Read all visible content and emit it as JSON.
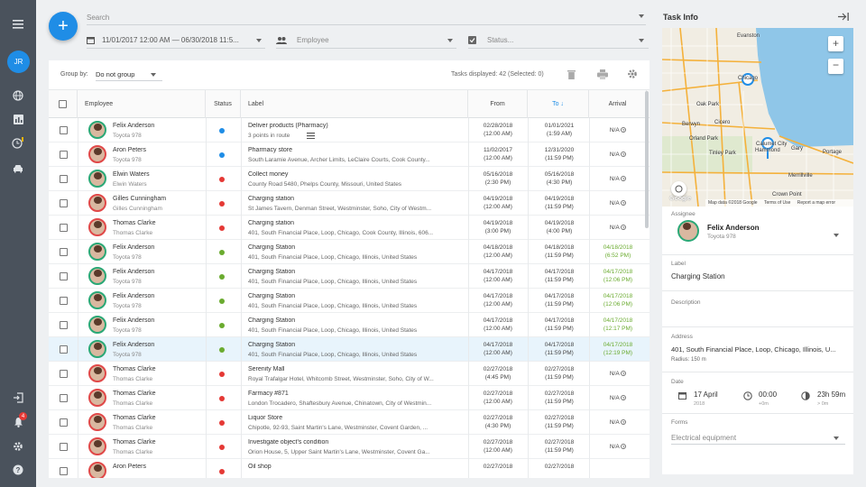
{
  "sidebar": {
    "avatar_initials": "JR",
    "notif_count": "4",
    "icons": [
      "menu-icon",
      "globe-icon",
      "chart-icon",
      "clock-icon",
      "car-icon",
      "logout-icon",
      "bell-icon",
      "gear-icon",
      "help-icon"
    ]
  },
  "search": {
    "placeholder": "Search"
  },
  "filters": {
    "date_range": "11/01/2017 12:00 AM — 06/30/2018 11:5...",
    "employee_placeholder": "Employee",
    "status_placeholder": "Status..."
  },
  "toolbar": {
    "group_by_label": "Group by:",
    "group_by_value": "Do not group",
    "tasks_displayed": "Tasks displayed: 42 (Selected: 0)"
  },
  "table": {
    "headers": {
      "employee": "Employee",
      "status": "Status",
      "label": "Label",
      "from": "From",
      "to": "To",
      "arrival": "Arrival"
    },
    "rows": [
      {
        "name": "Felix Anderson",
        "car": "Toyota 978",
        "status": "blue",
        "label": "Deliver products (Pharmacy)",
        "sub": "3 points in route",
        "from_d": "02/28/2018",
        "from_t": "(12:00 AM)",
        "to_d": "01/01/2021",
        "to_t": "(1:59 AM)",
        "arr": "N/A",
        "arr_t": "",
        "g": false,
        "sel": false,
        "female": false
      },
      {
        "name": "Aron Peters",
        "car": "Toyota 978",
        "status": "blue",
        "label": "Pharmacy store",
        "sub": "South Laramie Avenue, Archer Limits, LeClaire Courts, Cook County...",
        "from_d": "11/02/2017",
        "from_t": "(12:00 AM)",
        "to_d": "12/31/2020",
        "to_t": "(11:59 PM)",
        "arr": "N/A",
        "arr_t": "",
        "g": false,
        "sel": false,
        "female": true
      },
      {
        "name": "Elwin Waters",
        "car": "Elwin Waters",
        "status": "red",
        "label": "Collect money",
        "sub": "County Road 5480, Phelps County, Missouri, United States",
        "from_d": "05/16/2018",
        "from_t": "(2:30 PM)",
        "to_d": "05/16/2018",
        "to_t": "(4:30 PM)",
        "arr": "N/A",
        "arr_t": "",
        "g": false,
        "sel": false,
        "female": false
      },
      {
        "name": "Gilles Cunningham",
        "car": "Gilles Cunningham",
        "status": "red",
        "label": "Charging station",
        "sub": "St James Tavern, Denman Street, Westminster, Soho, City of Westm...",
        "from_d": "04/19/2018",
        "from_t": "(12:00 AM)",
        "to_d": "04/19/2018",
        "to_t": "(11:59 PM)",
        "arr": "N/A",
        "arr_t": "",
        "g": false,
        "sel": false,
        "female": true
      },
      {
        "name": "Thomas Clarke",
        "car": "Thomas Clarke",
        "status": "red",
        "label": "Charging station",
        "sub": "401, South Financial Place, Loop, Chicago, Cook County, Illinois, 606...",
        "from_d": "04/19/2018",
        "from_t": "(3:00 PM)",
        "to_d": "04/19/2018",
        "to_t": "(4:00 PM)",
        "arr": "N/A",
        "arr_t": "",
        "g": false,
        "sel": false,
        "female": true
      },
      {
        "name": "Felix Anderson",
        "car": "Toyota 978",
        "status": "green",
        "label": "Charging Station",
        "sub": "401, South Financial Place, Loop, Chicago, Illinois, United States",
        "from_d": "04/18/2018",
        "from_t": "(12:00 AM)",
        "to_d": "04/18/2018",
        "to_t": "(11:59 PM)",
        "arr": "04/18/2018",
        "arr_t": "(6:52 PM)",
        "g": true,
        "sel": false,
        "female": false
      },
      {
        "name": "Felix Anderson",
        "car": "Toyota 978",
        "status": "green",
        "label": "Charging Station",
        "sub": "401, South Financial Place, Loop, Chicago, Illinois, United States",
        "from_d": "04/17/2018",
        "from_t": "(12:00 AM)",
        "to_d": "04/17/2018",
        "to_t": "(11:59 PM)",
        "arr": "04/17/2018",
        "arr_t": "(12:06 PM)",
        "g": true,
        "sel": false,
        "female": false
      },
      {
        "name": "Felix Anderson",
        "car": "Toyota 978",
        "status": "green",
        "label": "Charging Station",
        "sub": "401, South Financial Place, Loop, Chicago, Illinois, United States",
        "from_d": "04/17/2018",
        "from_t": "(12:00 AM)",
        "to_d": "04/17/2018",
        "to_t": "(11:59 PM)",
        "arr": "04/17/2018",
        "arr_t": "(12:06 PM)",
        "g": true,
        "sel": false,
        "female": false
      },
      {
        "name": "Felix Anderson",
        "car": "Toyota 978",
        "status": "green",
        "label": "Charging Station",
        "sub": "401, South Financial Place, Loop, Chicago, Illinois, United States",
        "from_d": "04/17/2018",
        "from_t": "(12:00 AM)",
        "to_d": "04/17/2018",
        "to_t": "(11:59 PM)",
        "arr": "04/17/2018",
        "arr_t": "(12:17 PM)",
        "g": true,
        "sel": false,
        "female": false
      },
      {
        "name": "Felix Anderson",
        "car": "Toyota 978",
        "status": "green",
        "label": "Charging Station",
        "sub": "401, South Financial Place, Loop, Chicago, Illinois, United States",
        "from_d": "04/17/2018",
        "from_t": "(12:00 AM)",
        "to_d": "04/17/2018",
        "to_t": "(11:59 PM)",
        "arr": "04/17/2018",
        "arr_t": "(12:19 PM)",
        "g": true,
        "sel": true,
        "female": false
      },
      {
        "name": "Thomas Clarke",
        "car": "Thomas Clarke",
        "status": "red",
        "label": "Serenity Mall",
        "sub": "Royal Trafalgar Hotel, Whitcomb Street, Westminster, Soho, City of W...",
        "from_d": "02/27/2018",
        "from_t": "(4:45 PM)",
        "to_d": "02/27/2018",
        "to_t": "(11:59 PM)",
        "arr": "N/A",
        "arr_t": "",
        "g": false,
        "sel": false,
        "female": true
      },
      {
        "name": "Thomas Clarke",
        "car": "Thomas Clarke",
        "status": "red",
        "label": "Farmacy #871",
        "sub": "London Trocadero, Shaftesbury Avenue, Chinatown, City of Westmin...",
        "from_d": "02/27/2018",
        "from_t": "(12:00 AM)",
        "to_d": "02/27/2018",
        "to_t": "(11:59 PM)",
        "arr": "N/A",
        "arr_t": "",
        "g": false,
        "sel": false,
        "female": true
      },
      {
        "name": "Thomas Clarke",
        "car": "Thomas Clarke",
        "status": "red",
        "label": "Liquor Store",
        "sub": "Chipotle, 92-93, Saint Martin's Lane, Westminster, Covent Garden, ...",
        "from_d": "02/27/2018",
        "from_t": "(4:30 PM)",
        "to_d": "02/27/2018",
        "to_t": "(11:59 PM)",
        "arr": "N/A",
        "arr_t": "",
        "g": false,
        "sel": false,
        "female": true
      },
      {
        "name": "Thomas Clarke",
        "car": "Thomas Clarke",
        "status": "red",
        "label": "Investigate object's condition",
        "sub": "Orion House, 5, Upper Saint Martin's Lane, Westminster, Covent Ga...",
        "from_d": "02/27/2018",
        "from_t": "(12:00 AM)",
        "to_d": "02/27/2018",
        "to_t": "(11:59 PM)",
        "arr": "N/A",
        "arr_t": "",
        "g": false,
        "sel": false,
        "female": true
      },
      {
        "name": "Aron Peters",
        "car": "",
        "status": "red",
        "label": "Oil shop",
        "sub": "",
        "from_d": "02/27/2018",
        "from_t": "",
        "to_d": "02/27/2018",
        "to_t": "",
        "arr": "",
        "arr_t": "",
        "g": false,
        "sel": false,
        "female": true
      }
    ]
  },
  "task_info": {
    "title": "Task Info",
    "map": {
      "labels": [
        "Evanston",
        "Chicago",
        "Oak Park",
        "Berwyn",
        "Cicero",
        "Orland Park",
        "Tinley Park",
        "Calumet City",
        "Hammond",
        "Gary",
        "Portage",
        "Merrillville",
        "Crown Point"
      ],
      "attribution": "Map data ©2018 Google",
      "terms": "Terms of Use",
      "report": "Report a map error",
      "logo": "Google"
    },
    "assignee_label": "Assignee",
    "assignee_name": "Felix Anderson",
    "assignee_car": "Toyota 978",
    "label_label": "Label",
    "label_value": "Charging Station",
    "desc_label": "Description",
    "address_label": "Address",
    "address_value": "401, South Financial Place, Loop, Chicago, Illinois, U...",
    "radius": "Radius: 150 m",
    "date_label": "Date",
    "date_value": "17 April",
    "date_year": "2018",
    "time_value": "00:00",
    "time_sub": "+0m",
    "dur_value": "23h 59m",
    "dur_sub": "> 0m",
    "forms_label": "Forms",
    "forms_value": "Electrical equipment"
  },
  "colors": {
    "accent": "#1f8de6",
    "sidebar": "#4a525c",
    "green": "#6aab2f",
    "red": "#e53935",
    "blue": "#1f8de6"
  }
}
